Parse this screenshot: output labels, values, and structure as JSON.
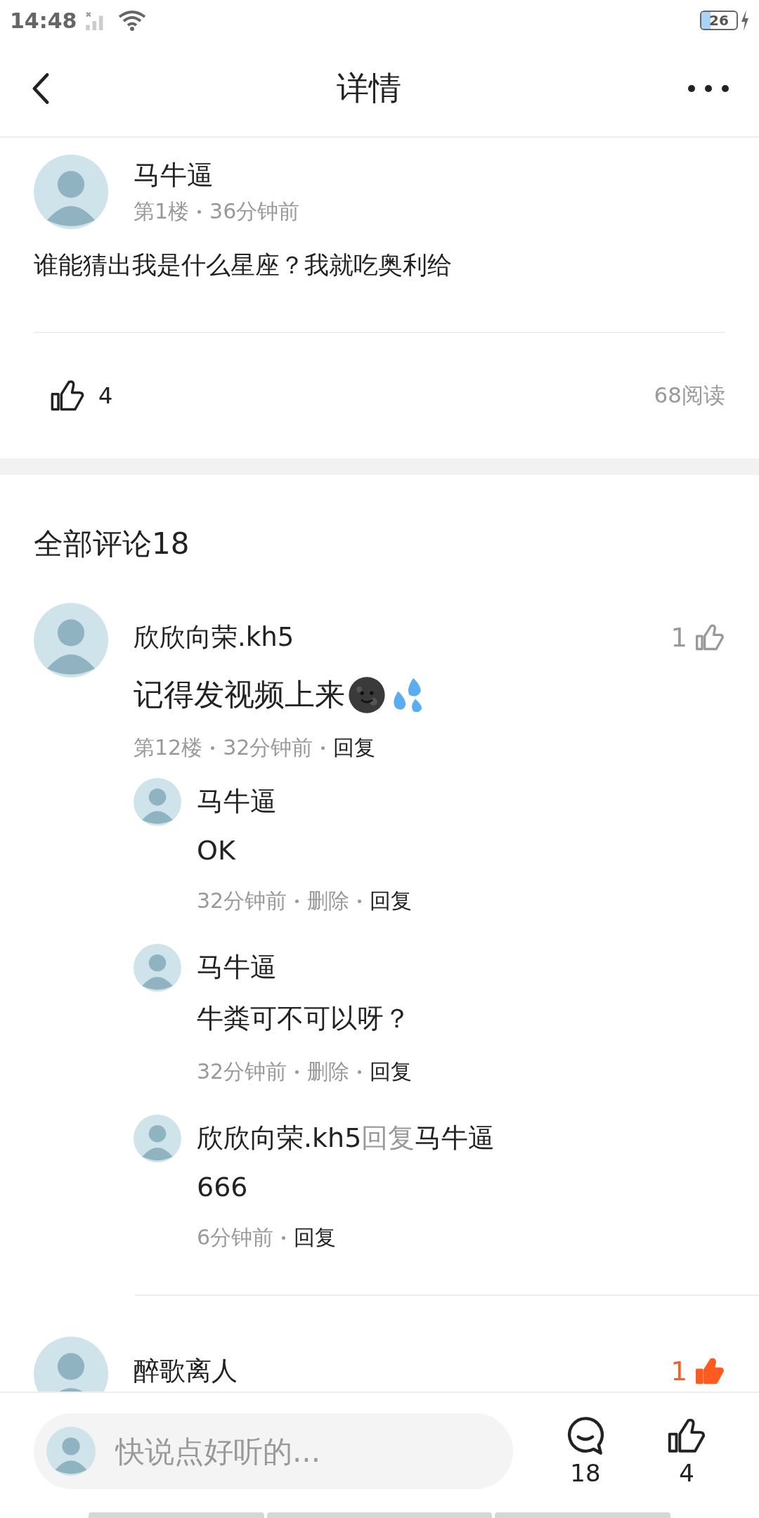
{
  "status_bar": {
    "time": "14:48",
    "battery": "26"
  },
  "header": {
    "title": "详情"
  },
  "post": {
    "author": "马牛逼",
    "floor": "第1楼",
    "time": "36分钟前",
    "content": "谁能猜出我是什么星座？我就吃奥利给",
    "likes": "4",
    "liked": false,
    "reads": "68阅读"
  },
  "comments_title": "全部评论18",
  "comments": [
    {
      "author": "欣欣向荣.kh5",
      "likes": "1",
      "liked": false,
      "content": "记得发视频上来",
      "emoji": [
        {
          "kind": "moon_face"
        },
        {
          "kind": "droplets"
        }
      ],
      "floor": "第12楼",
      "time": "32分钟前",
      "reply": "回复",
      "replies": [
        {
          "author": "马牛逼",
          "content": "OK",
          "time": "32分钟前",
          "actions": [
            {
              "label": "删除",
              "kind": "muted"
            },
            {
              "label": "回复",
              "kind": "link"
            }
          ]
        },
        {
          "author": "马牛逼",
          "content": "牛粪可不可以呀？",
          "time": "32分钟前",
          "actions": [
            {
              "label": "删除",
              "kind": "muted"
            },
            {
              "label": "回复",
              "kind": "link"
            }
          ]
        },
        {
          "author": "欣欣向荣.kh5",
          "reply_word": "回复",
          "reply_to": "马牛逼",
          "content": "666",
          "time": "6分钟前",
          "actions": [
            {
              "label": "回复",
              "kind": "link"
            }
          ]
        }
      ]
    },
    {
      "author": "醉歌离人",
      "likes": "1",
      "liked": true
    }
  ],
  "bottom_bar": {
    "placeholder": "快说点好听的...",
    "comment_count": "18",
    "like_count": "4"
  }
}
